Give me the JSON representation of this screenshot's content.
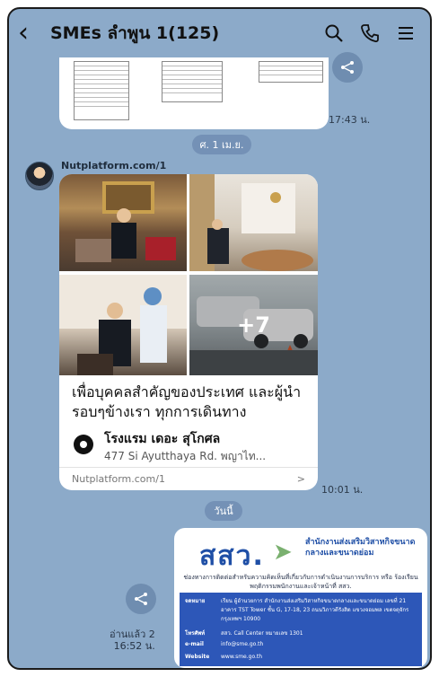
{
  "header": {
    "back_icon": "chevron-left-icon",
    "title": "SMEs ลำพูน 1(125)",
    "icons": [
      "search-icon",
      "phone-icon",
      "menu-icon"
    ]
  },
  "messages": {
    "sheet_time": "17:43 น.",
    "date_chip_1": "ศ. 1 เม.ย.",
    "sender": "Nutplatform.com/1",
    "post": {
      "text": "เพื่อบุคคลสำคัญของประเทศ และผู้นำรอบๆข้างเรา ทุกการเดินทาง",
      "more_count": "+7",
      "place_name": "โรงแรม เดอะ สุโกศล",
      "place_address": "477 Si Ayutthaya Rd. พญาไท...",
      "footer_source": "Nutplatform.com/1",
      "footer_arrow": ">"
    },
    "post_time": "10:01 น.",
    "date_chip_2": "วันนี้",
    "sme_card": {
      "logo_text": "สสว.",
      "org_name": "สำนักงานส่งเสริมวิสาหกิจขนาดกลางและขนาดย่อม",
      "subtitle": "ช่องทางการติดต่อสำหรับความคิดเห็นที่เกี่ยวกับการดำเนินงานการบริการ หรือ ร้องเรียนพฤติกรรมพนักงานและเจ้าหน้าที่ สสว.",
      "rows": [
        {
          "key": "จดหมาย",
          "value": "เรียน ผู้อำนวยการ สำนักงานส่งเสริมวิสาหกิจขนาดกลางและขนาดย่อม เลขที่ 21 อาคาร TST Tower ชั้น G, 17-18, 23 ถนนวิภาวดีรังสิต แขวงจอมพล เขตจตุจักร กรุงเทพฯ 10900"
        },
        {
          "key": "โทรศัพท์",
          "value": "สสว. Call Center หมายเลข 1301"
        },
        {
          "key": "e-mail",
          "value": "info@sme.go.th"
        },
        {
          "key": "Website",
          "value": "www.sme.go.th"
        }
      ]
    },
    "read_receipt": "อ่านแล้ว 2",
    "sme_time": "16:52 น."
  }
}
